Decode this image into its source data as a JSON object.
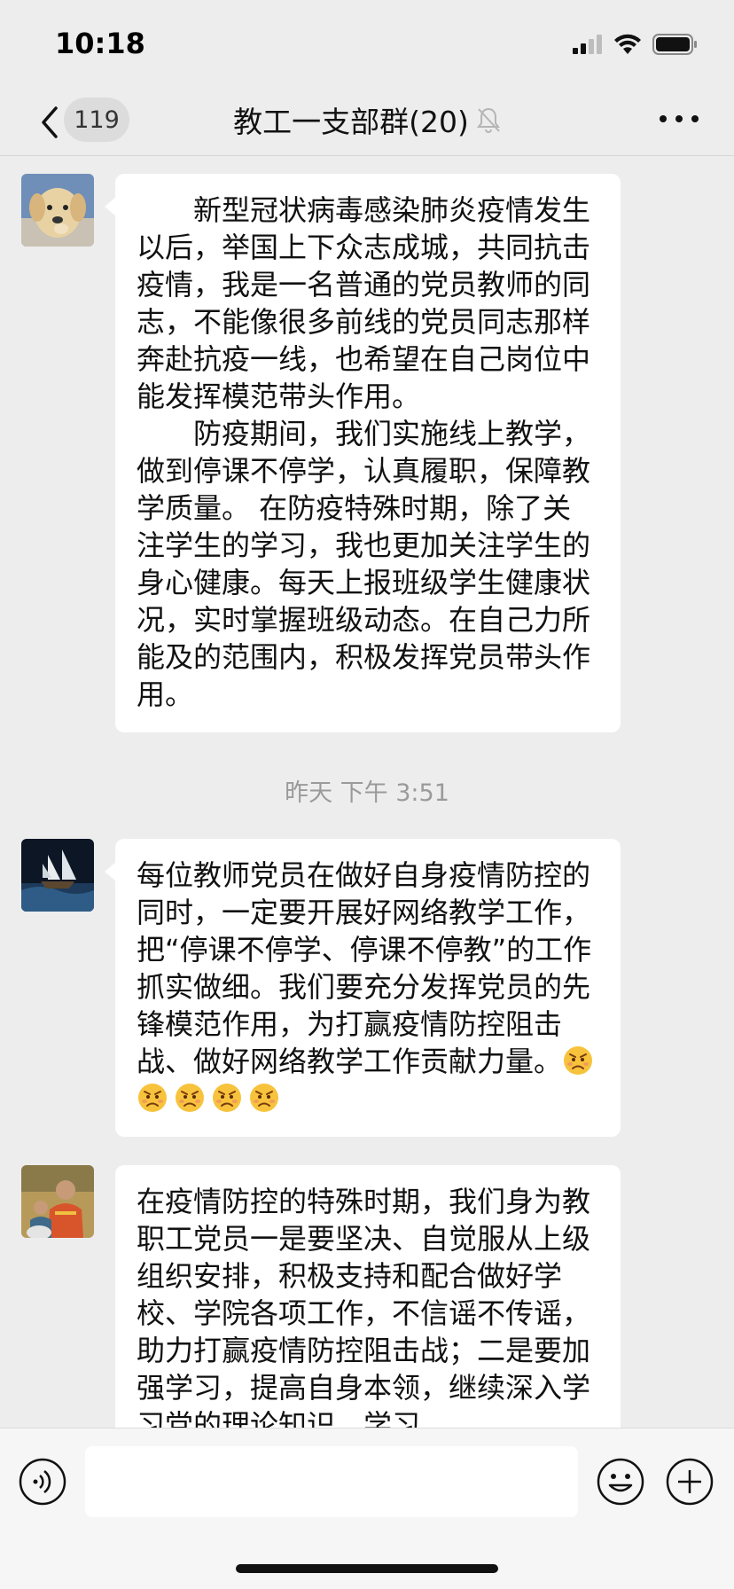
{
  "status_bar": {
    "time": "10:18",
    "icons": [
      "signal-icon",
      "wifi-icon",
      "battery-icon"
    ]
  },
  "nav": {
    "unread_count": "119",
    "title": "教工一支部群(20)",
    "icons": [
      "back-icon",
      "mute-bell-icon",
      "more-icon"
    ]
  },
  "messages": [
    {
      "paragraphs": [
        "新型冠状病毒感染肺炎疫情发生以后，举国上下众志成城，共同抗击疫情，我是一名普通的党员教师的同志，不能像很多前线的党员同志那样奔赴抗疫一线，也希望在自己岗位中能发挥模范带头作用。",
        "防疫期间，我们实施线上教学，做到停课不停学，认真履职，保障教学质量。 在防疫特殊时期，除了关注学生的学习，我也更加关注学生的身心健康。每天上报班级学生健康状况，实时掌握班级动态。在自己力所能及的范围内，积极发挥党员带头作用。"
      ]
    },
    {
      "text": "每位教师党员在做好自身疫情防控的同时，一定要开展好网络教学工作，把“停课不停学、停课不停教”的工作抓实做细。我们要充分发挥党员的先锋模范作用，为打赢疫情防控阻击战、做好网络教学工作贡献力量。",
      "emoji_count": 5,
      "emoji": "angry-frown-emoji"
    },
    {
      "text": "在疫情防控的特殊时期，我们身为教职工党员一是要坚决、自觉服从上级组织安排，积极支持和配合做好学校、学院各项工作，不信谣不传谣，助力打赢疫情防控阻击战；二是要加强学习，提高自身本领，继续深入学习党的理论知识，学习"
    }
  ],
  "timestamp": "昨天 下午 3:51",
  "input_bar": {
    "icons": [
      "voice-icon",
      "emoji-icon",
      "plus-icon"
    ],
    "text_value": ""
  },
  "colors": {
    "background": "#ededed",
    "bubble": "#ffffff",
    "timestamp": "#9a9a9a"
  }
}
